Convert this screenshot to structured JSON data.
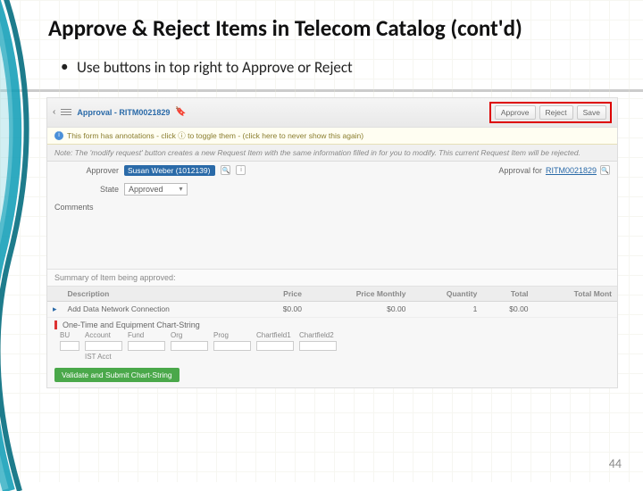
{
  "slide": {
    "title": "Approve & Reject Items in Telecom Catalog (cont'd)",
    "bullet1": "Use buttons in top right to Approve or Reject",
    "page_number": "44"
  },
  "app": {
    "record_label": "Approval - RITM0021829",
    "buttons": {
      "approve": "Approve",
      "reject": "Reject",
      "save": "Save"
    },
    "annotation": "This form has annotations - click ⓘ to toggle them - (click here to never show this again)",
    "note": "Note: The 'modify request' button creates a new Request Item with the same information filled in for you to modify. This current Request Item will be rejected.",
    "approver_label": "Approver",
    "approver_value": "Susan Weber (1012139)",
    "approval_for_label": "Approval for",
    "approval_for_value": "RITM0021829",
    "state_label": "State",
    "state_value": "Approved",
    "comments_label": "Comments",
    "summary_label": "Summary of Item being approved:",
    "table": {
      "headers": {
        "desc": "Description",
        "price": "Price",
        "price_monthly": "Price Monthly",
        "qty": "Quantity",
        "total": "Total",
        "total_monthly": "Total Mont"
      },
      "row": {
        "desc": "Add Data Network Connection",
        "price": "$0.00",
        "price_monthly": "$0.00",
        "qty": "1",
        "total": "$0.00",
        "total_monthly": ""
      }
    },
    "chartstring_label": "One-Time and Equipment Chart-String",
    "cs_headers": {
      "bu": "BU",
      "account": "Account",
      "fund": "Fund",
      "org": "Org",
      "prog": "Prog",
      "cf1": "Chartfield1",
      "cf2": "Chartfield2"
    },
    "ist_label": "IST Acct",
    "validate": "Validate and Submit Chart-String"
  }
}
